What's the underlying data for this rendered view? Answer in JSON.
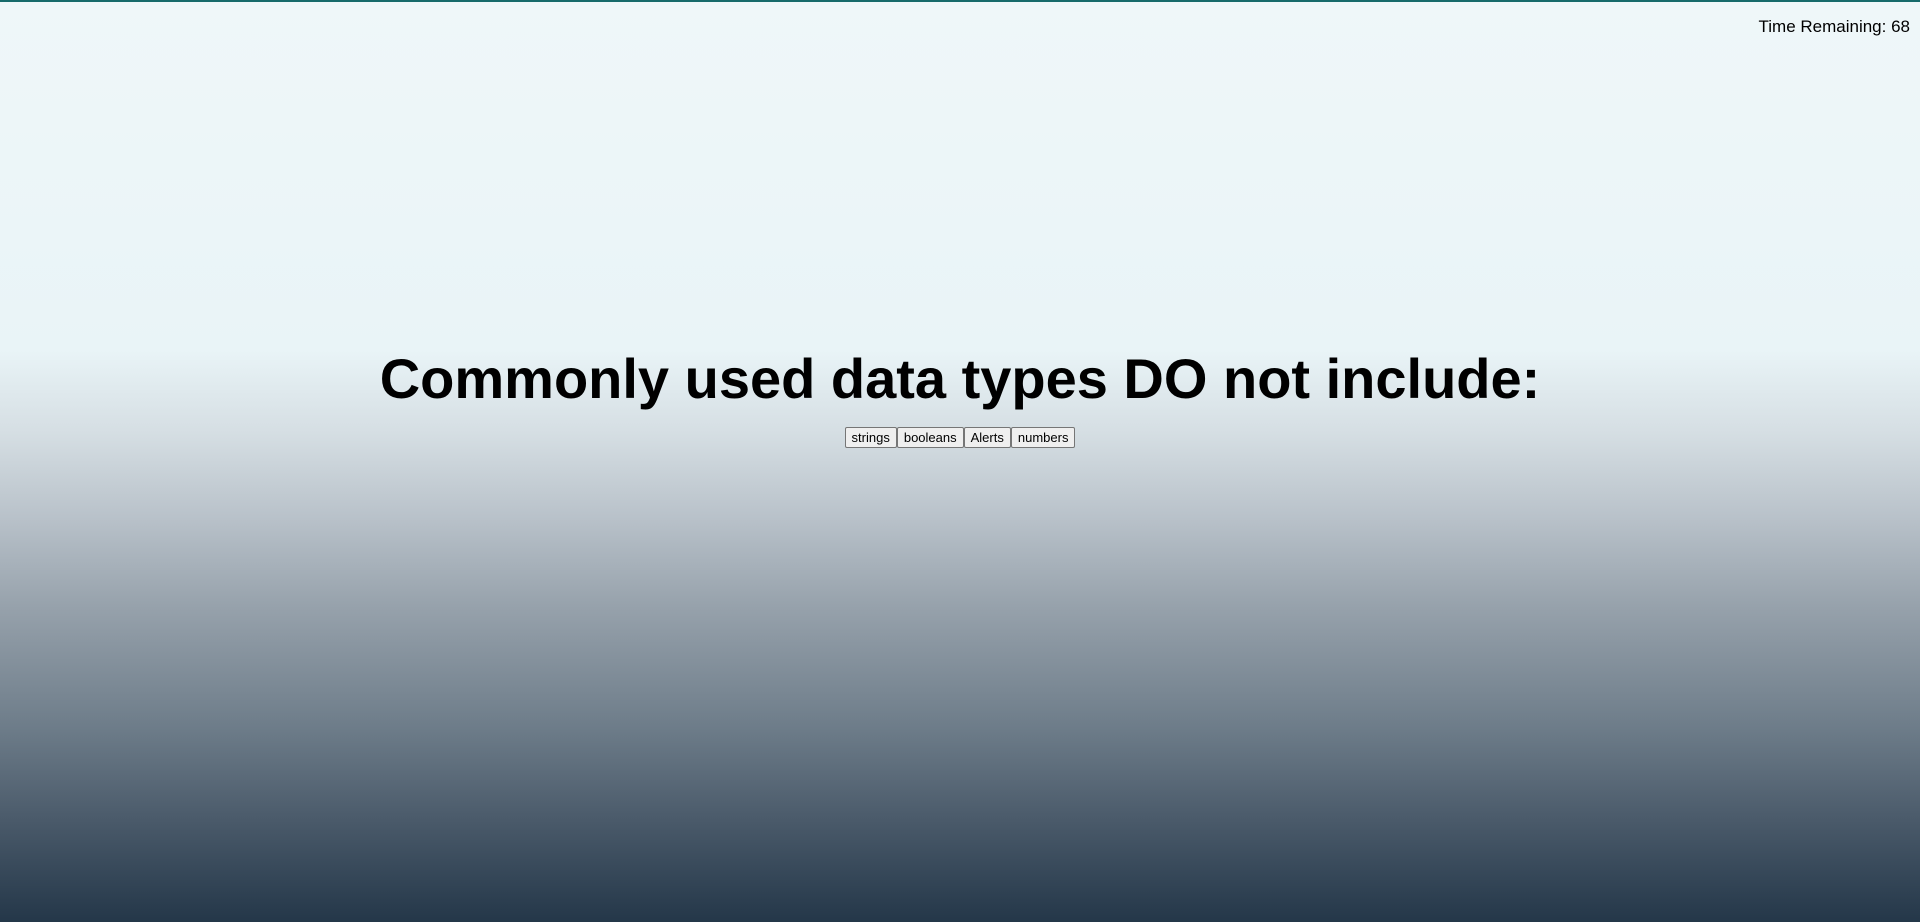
{
  "timer": {
    "label": "Time Remaining: 68"
  },
  "quiz": {
    "question": "Commonly used data types DO not include:",
    "choices": [
      "strings",
      "booleans",
      "Alerts",
      "numbers"
    ]
  },
  "colors": {
    "top_bar": "#176a6b",
    "background_top": "#eff7f9",
    "background_bottom": "#243749"
  }
}
